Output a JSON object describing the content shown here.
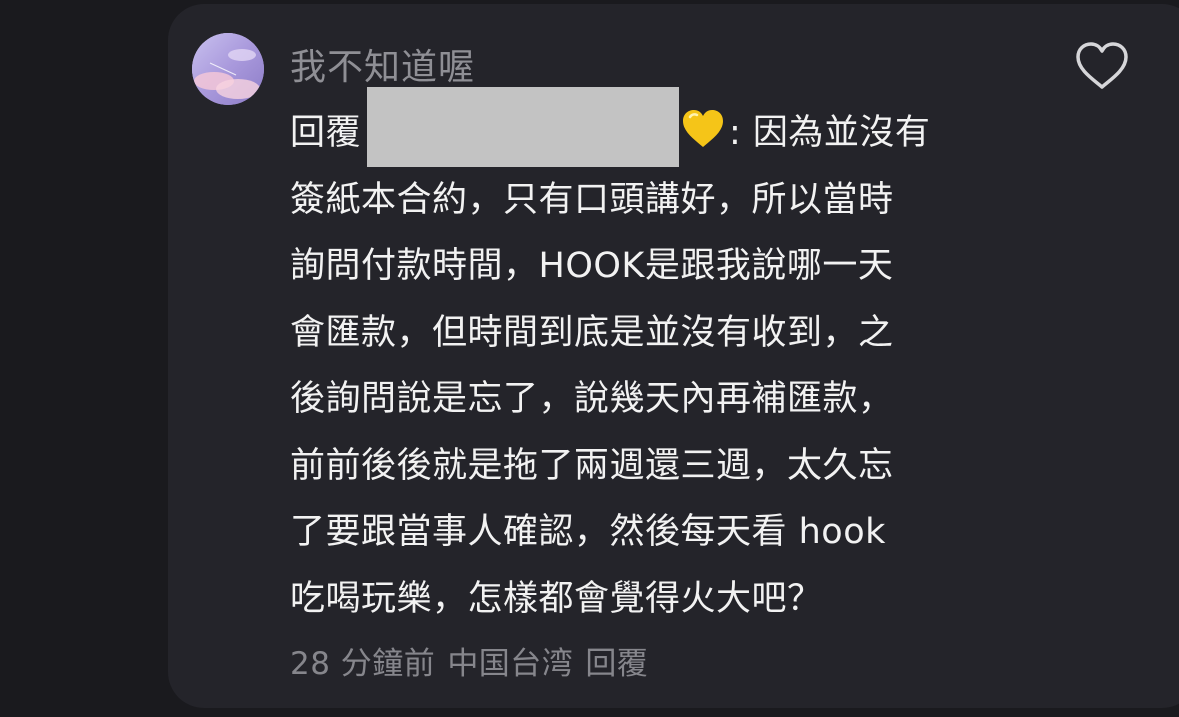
{
  "comment": {
    "username": "我不知道喔",
    "reply_prefix": "回覆",
    "reply_suffix": ": 因為並沒有",
    "body_lines": [
      "簽紙本合約，只有口頭講好，所以當時",
      "詢問付款時間，HOOK是跟我說哪一天",
      "會匯款，但時間到底是並沒有收到，之",
      "後詢問說是忘了，說幾天內再補匯款，",
      "前前後後就是拖了兩週還三週，太久忘",
      "了要跟當事人確認，然後每天看 hook",
      "吃喝玩樂，怎樣都會覺得火大吧？"
    ],
    "timestamp": "28 分鐘前",
    "location": "中国台湾",
    "reply_label": "回覆"
  },
  "icons": {
    "like": "heart-outline-icon",
    "emoji": "yellow-heart-emoji"
  },
  "colors": {
    "background": "#1a1a1e",
    "card": "#24242a",
    "text": "#f2f2f2",
    "muted": "#8f8f95",
    "redaction": "#c3c3c3",
    "emoji_heart": "#f5c518"
  }
}
